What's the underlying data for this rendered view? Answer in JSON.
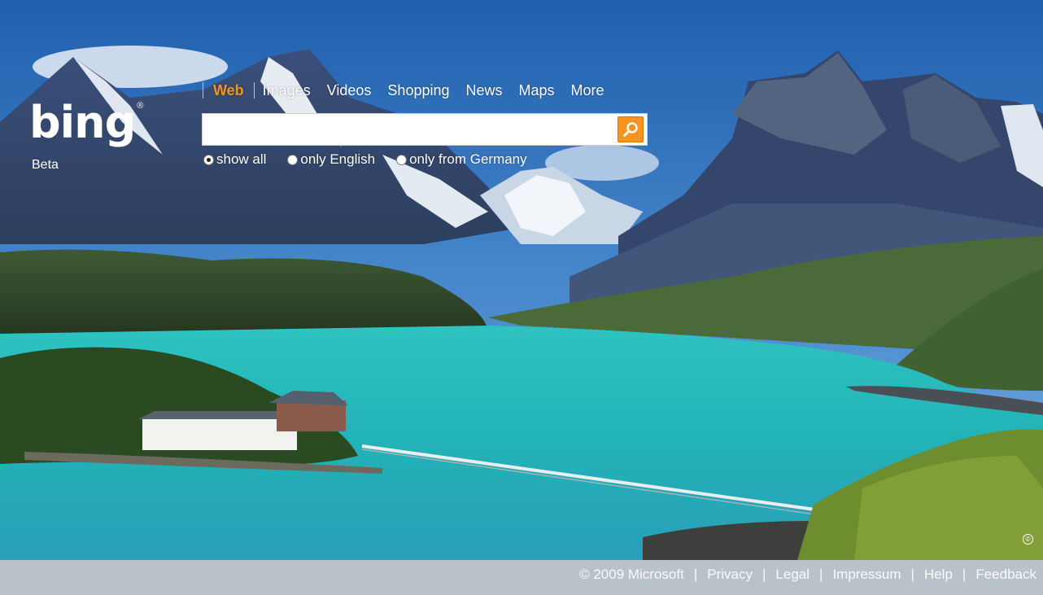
{
  "logo": {
    "text": "bing",
    "tm": "®",
    "subtitle": "Beta"
  },
  "nav": {
    "items": [
      {
        "label": "Web",
        "active": true
      },
      {
        "label": "Images"
      },
      {
        "label": "Videos"
      },
      {
        "label": "Shopping"
      },
      {
        "label": "News"
      },
      {
        "label": "Maps"
      },
      {
        "label": "More"
      }
    ]
  },
  "search": {
    "value": "",
    "placeholder": "",
    "button_icon": "magnifier-icon"
  },
  "scope": {
    "options": [
      {
        "label": "show all",
        "selected": true
      },
      {
        "label": "only English",
        "selected": false
      },
      {
        "label": "only from Germany",
        "selected": false
      }
    ]
  },
  "image_info_icon": "©",
  "footer": {
    "copyright": "© 2009 Microsoft",
    "links": [
      "Privacy",
      "Legal",
      "Impressum",
      "Help",
      "Feedback"
    ]
  },
  "colors": {
    "accent": "#f7931e",
    "footer_bg": "#b9c2c8",
    "lake": "#27b6b6",
    "sky": "#2f6fb8"
  }
}
